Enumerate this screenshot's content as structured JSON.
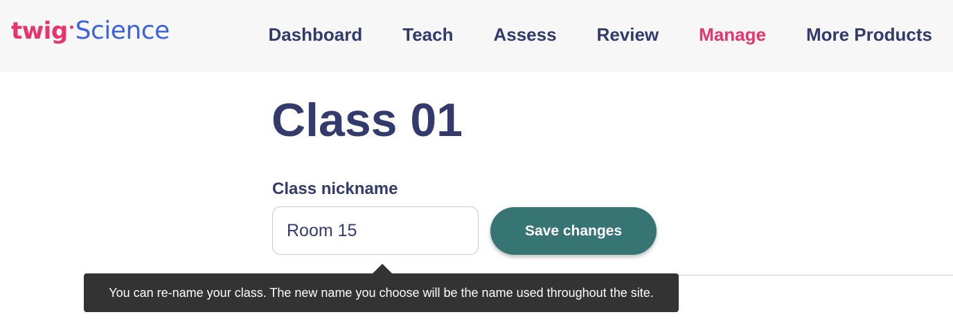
{
  "colors": {
    "navy": "#323a6e",
    "pink": "#e8336d",
    "blue": "#3b63e0",
    "teal": "#377574",
    "tooltip_bg": "#333333",
    "navbar_bg": "#f7f7f7"
  },
  "logo": {
    "part1": "twig",
    "part2": "Science"
  },
  "nav": {
    "items": [
      {
        "label": "Dashboard",
        "active": false
      },
      {
        "label": "Teach",
        "active": false
      },
      {
        "label": "Assess",
        "active": false
      },
      {
        "label": "Review",
        "active": false
      },
      {
        "label": "Manage",
        "active": true
      },
      {
        "label": "More Products",
        "active": false
      }
    ]
  },
  "main": {
    "title": "Class 01",
    "nickname_label": "Class nickname",
    "nickname_value": "Room 15",
    "save_label": "Save changes"
  },
  "tooltip": {
    "text": "You can re-name your class. The new name you choose will be the name used throughout the site."
  }
}
